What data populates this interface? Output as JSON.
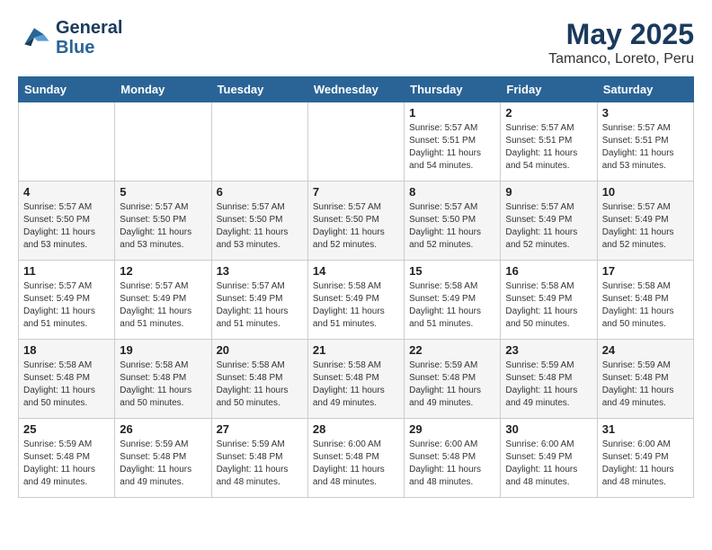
{
  "header": {
    "logo_general": "General",
    "logo_blue": "Blue",
    "month_title": "May 2025",
    "location": "Tamanco, Loreto, Peru"
  },
  "days_of_week": [
    "Sunday",
    "Monday",
    "Tuesday",
    "Wednesday",
    "Thursday",
    "Friday",
    "Saturday"
  ],
  "weeks": [
    [
      {
        "day": "",
        "info": ""
      },
      {
        "day": "",
        "info": ""
      },
      {
        "day": "",
        "info": ""
      },
      {
        "day": "",
        "info": ""
      },
      {
        "day": "1",
        "info": "Sunrise: 5:57 AM\nSunset: 5:51 PM\nDaylight: 11 hours\nand 54 minutes."
      },
      {
        "day": "2",
        "info": "Sunrise: 5:57 AM\nSunset: 5:51 PM\nDaylight: 11 hours\nand 54 minutes."
      },
      {
        "day": "3",
        "info": "Sunrise: 5:57 AM\nSunset: 5:51 PM\nDaylight: 11 hours\nand 53 minutes."
      }
    ],
    [
      {
        "day": "4",
        "info": "Sunrise: 5:57 AM\nSunset: 5:50 PM\nDaylight: 11 hours\nand 53 minutes."
      },
      {
        "day": "5",
        "info": "Sunrise: 5:57 AM\nSunset: 5:50 PM\nDaylight: 11 hours\nand 53 minutes."
      },
      {
        "day": "6",
        "info": "Sunrise: 5:57 AM\nSunset: 5:50 PM\nDaylight: 11 hours\nand 53 minutes."
      },
      {
        "day": "7",
        "info": "Sunrise: 5:57 AM\nSunset: 5:50 PM\nDaylight: 11 hours\nand 52 minutes."
      },
      {
        "day": "8",
        "info": "Sunrise: 5:57 AM\nSunset: 5:50 PM\nDaylight: 11 hours\nand 52 minutes."
      },
      {
        "day": "9",
        "info": "Sunrise: 5:57 AM\nSunset: 5:49 PM\nDaylight: 11 hours\nand 52 minutes."
      },
      {
        "day": "10",
        "info": "Sunrise: 5:57 AM\nSunset: 5:49 PM\nDaylight: 11 hours\nand 52 minutes."
      }
    ],
    [
      {
        "day": "11",
        "info": "Sunrise: 5:57 AM\nSunset: 5:49 PM\nDaylight: 11 hours\nand 51 minutes."
      },
      {
        "day": "12",
        "info": "Sunrise: 5:57 AM\nSunset: 5:49 PM\nDaylight: 11 hours\nand 51 minutes."
      },
      {
        "day": "13",
        "info": "Sunrise: 5:57 AM\nSunset: 5:49 PM\nDaylight: 11 hours\nand 51 minutes."
      },
      {
        "day": "14",
        "info": "Sunrise: 5:58 AM\nSunset: 5:49 PM\nDaylight: 11 hours\nand 51 minutes."
      },
      {
        "day": "15",
        "info": "Sunrise: 5:58 AM\nSunset: 5:49 PM\nDaylight: 11 hours\nand 51 minutes."
      },
      {
        "day": "16",
        "info": "Sunrise: 5:58 AM\nSunset: 5:49 PM\nDaylight: 11 hours\nand 50 minutes."
      },
      {
        "day": "17",
        "info": "Sunrise: 5:58 AM\nSunset: 5:48 PM\nDaylight: 11 hours\nand 50 minutes."
      }
    ],
    [
      {
        "day": "18",
        "info": "Sunrise: 5:58 AM\nSunset: 5:48 PM\nDaylight: 11 hours\nand 50 minutes."
      },
      {
        "day": "19",
        "info": "Sunrise: 5:58 AM\nSunset: 5:48 PM\nDaylight: 11 hours\nand 50 minutes."
      },
      {
        "day": "20",
        "info": "Sunrise: 5:58 AM\nSunset: 5:48 PM\nDaylight: 11 hours\nand 50 minutes."
      },
      {
        "day": "21",
        "info": "Sunrise: 5:58 AM\nSunset: 5:48 PM\nDaylight: 11 hours\nand 49 minutes."
      },
      {
        "day": "22",
        "info": "Sunrise: 5:59 AM\nSunset: 5:48 PM\nDaylight: 11 hours\nand 49 minutes."
      },
      {
        "day": "23",
        "info": "Sunrise: 5:59 AM\nSunset: 5:48 PM\nDaylight: 11 hours\nand 49 minutes."
      },
      {
        "day": "24",
        "info": "Sunrise: 5:59 AM\nSunset: 5:48 PM\nDaylight: 11 hours\nand 49 minutes."
      }
    ],
    [
      {
        "day": "25",
        "info": "Sunrise: 5:59 AM\nSunset: 5:48 PM\nDaylight: 11 hours\nand 49 minutes."
      },
      {
        "day": "26",
        "info": "Sunrise: 5:59 AM\nSunset: 5:48 PM\nDaylight: 11 hours\nand 49 minutes."
      },
      {
        "day": "27",
        "info": "Sunrise: 5:59 AM\nSunset: 5:48 PM\nDaylight: 11 hours\nand 48 minutes."
      },
      {
        "day": "28",
        "info": "Sunrise: 6:00 AM\nSunset: 5:48 PM\nDaylight: 11 hours\nand 48 minutes."
      },
      {
        "day": "29",
        "info": "Sunrise: 6:00 AM\nSunset: 5:48 PM\nDaylight: 11 hours\nand 48 minutes."
      },
      {
        "day": "30",
        "info": "Sunrise: 6:00 AM\nSunset: 5:49 PM\nDaylight: 11 hours\nand 48 minutes."
      },
      {
        "day": "31",
        "info": "Sunrise: 6:00 AM\nSunset: 5:49 PM\nDaylight: 11 hours\nand 48 minutes."
      }
    ]
  ]
}
